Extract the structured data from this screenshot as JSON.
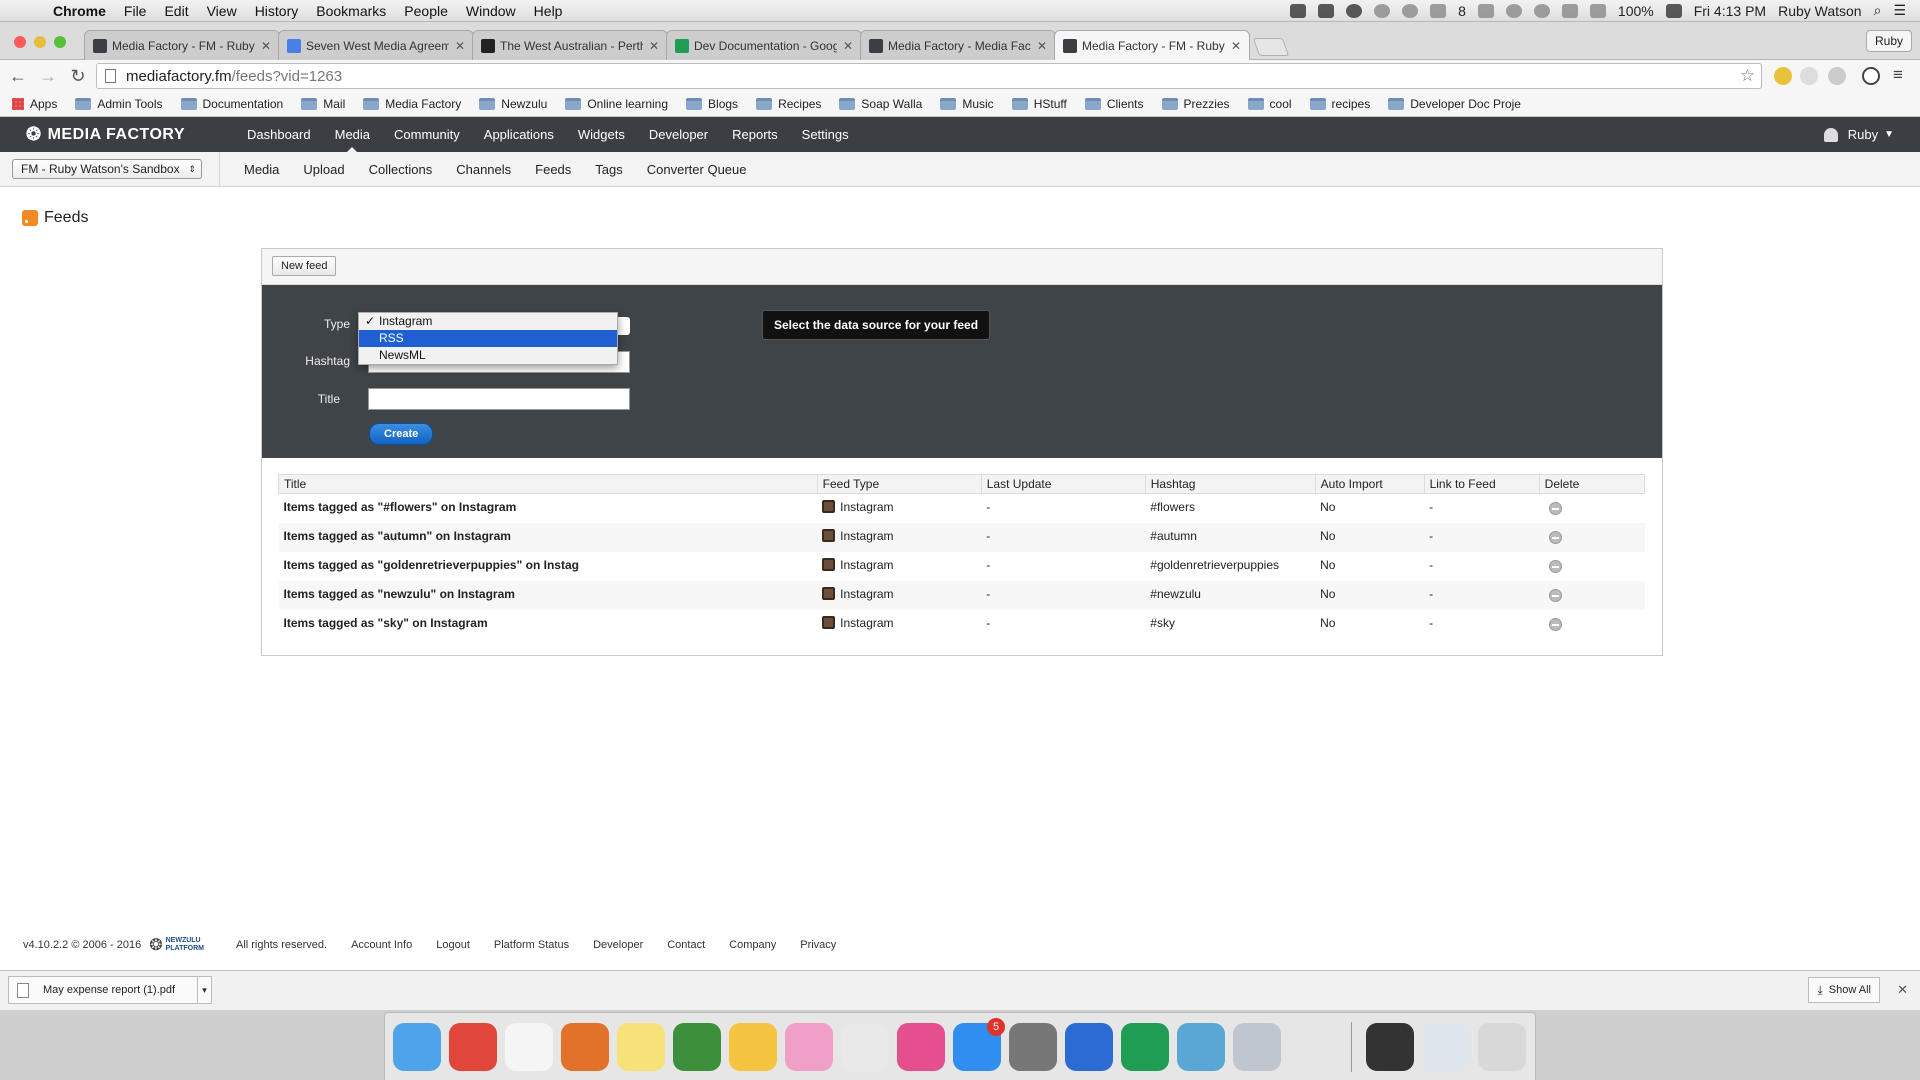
{
  "mac_menu": {
    "app": "Chrome",
    "items": [
      "File",
      "Edit",
      "View",
      "History",
      "Bookmarks",
      "People",
      "Window",
      "Help"
    ],
    "status": {
      "notification_count": "8",
      "battery": "100%",
      "clock": "Fri 4:13 PM",
      "user": "Ruby Watson"
    }
  },
  "browser": {
    "tabs": [
      {
        "title": "Media Factory - FM - Ruby",
        "icon": "media-factory-icon",
        "color": "#3b3f44"
      },
      {
        "title": "Seven West Media Agreeme",
        "icon": "google-docs-icon",
        "color": "#4a7ee8"
      },
      {
        "title": "The West Australian - Perth",
        "icon": "west-australian-icon",
        "color": "#222222"
      },
      {
        "title": "Dev Documentation - Goog",
        "icon": "google-sheets-icon",
        "color": "#1f9d55"
      },
      {
        "title": "Media Factory - Media Fact",
        "icon": "media-factory-icon",
        "color": "#3b3f44"
      },
      {
        "title": "Media Factory - FM - Ruby",
        "icon": "media-factory-icon",
        "color": "#3b3f44",
        "active": true
      }
    ],
    "profile": "Ruby",
    "url_host": "mediafactory.fm",
    "url_path": "/feeds?vid=1263",
    "bookmarks": [
      "Apps",
      "Admin Tools",
      "Documentation",
      "Mail",
      "Media Factory",
      "Newzulu",
      "Online learning",
      "Blogs",
      "Recipes",
      "Soap Walla",
      "Music",
      "HStuff",
      "Clients",
      "Prezzies",
      "cool",
      "recipes",
      "Developer Doc Proje"
    ]
  },
  "app": {
    "logo": "MEDIA FACTORY",
    "nav": [
      "Dashboard",
      "Media",
      "Community",
      "Applications",
      "Widgets",
      "Developer",
      "Reports",
      "Settings"
    ],
    "nav_active": "Media",
    "user": "Ruby",
    "sandbox": "FM - Ruby Watson's Sandbox",
    "subnav": [
      "Media",
      "Upload",
      "Collections",
      "Channels",
      "Feeds",
      "Tags",
      "Converter Queue"
    ]
  },
  "page": {
    "title": "Feeds",
    "new_feed_button": "New feed",
    "form": {
      "type_label": "Type",
      "hashtag_label": "Hashtag",
      "title_label": "Title",
      "title_value": "",
      "type_options": [
        "Instagram",
        "RSS",
        "NewsML"
      ],
      "type_selected": "Instagram",
      "type_highlighted": "RSS",
      "create_button": "Create",
      "tooltip": "Select the data source for your feed"
    },
    "table": {
      "columns": [
        "Title",
        "Feed Type",
        "Last Update",
        "Hashtag",
        "Auto Import",
        "Link to Feed",
        "Delete"
      ],
      "rows": [
        {
          "title": "Items tagged as \"#flowers\" on Instagram",
          "type": "Instagram",
          "last_update": "-",
          "hashtag": "#flowers",
          "auto_import": "No",
          "link": "-"
        },
        {
          "title": "Items tagged as \"autumn\" on Instagram",
          "type": "Instagram",
          "last_update": "-",
          "hashtag": "#autumn",
          "auto_import": "No",
          "link": "-"
        },
        {
          "title": "Items tagged as \"goldenretrieverpuppies\" on Instag",
          "type": "Instagram",
          "last_update": "-",
          "hashtag": "#goldenretrieverpuppies",
          "auto_import": "No",
          "link": "-"
        },
        {
          "title": "Items tagged as \"newzulu\" on Instagram",
          "type": "Instagram",
          "last_update": "-",
          "hashtag": "#newzulu",
          "auto_import": "No",
          "link": "-"
        },
        {
          "title": "Items tagged as \"sky\" on Instagram",
          "type": "Instagram",
          "last_update": "-",
          "hashtag": "#sky",
          "auto_import": "No",
          "link": "-"
        }
      ]
    }
  },
  "footer": {
    "version": "v4.10.2.2 © 2006 - 2016",
    "brand_line1": "NEWZULU",
    "brand_line2": "PLATFORM",
    "rights": "All rights reserved.",
    "links": [
      "Account Info",
      "Logout",
      "Platform Status",
      "Developer",
      "Contact",
      "Company",
      "Privacy"
    ]
  },
  "downloads": {
    "file": "May expense report (1).pdf",
    "show_all": "Show All"
  },
  "dock": {
    "apps": [
      {
        "name": "finder-icon",
        "color": "#4fa3e8"
      },
      {
        "name": "chrome-icon",
        "color": "#e0473a"
      },
      {
        "name": "calendar-icon",
        "color": "#f5f5f5"
      },
      {
        "name": "firefox-icon",
        "color": "#e2712a"
      },
      {
        "name": "notes-icon",
        "color": "#f7e27a"
      },
      {
        "name": "evernote-icon",
        "color": "#3d8f3b"
      },
      {
        "name": "google-drive-icon",
        "color": "#f5c542"
      },
      {
        "name": "photos-icon",
        "color": "#f0a0c8"
      },
      {
        "name": "slack-icon",
        "color": "#e8e8e8"
      },
      {
        "name": "itunes-icon",
        "color": "#e54f8f"
      },
      {
        "name": "app-store-icon",
        "color": "#2f8ef0",
        "badge": "5"
      },
      {
        "name": "system-preferences-icon",
        "color": "#777777"
      },
      {
        "name": "word-icon",
        "color": "#2b6cd4"
      },
      {
        "name": "excel-icon",
        "color": "#1f9d55"
      },
      {
        "name": "network-globe-icon",
        "color": "#5aa7d6"
      },
      {
        "name": "utility-icon",
        "color": "#bfc6cf"
      },
      {
        "name": "printer-icon",
        "color": "#e6e6e6"
      }
    ],
    "extras": [
      {
        "name": "downloads-stack-icon",
        "color": "#333333"
      },
      {
        "name": "documents-stack-icon",
        "color": "#dfe6ee"
      },
      {
        "name": "trash-icon",
        "color": "#d8d8d8"
      }
    ]
  },
  "colors": {
    "app_nav_bg": "#3b3f44",
    "form_bg": "#3f4449",
    "primary_button": "#1162c4",
    "dropdown_highlight": "#1f5fd1"
  }
}
